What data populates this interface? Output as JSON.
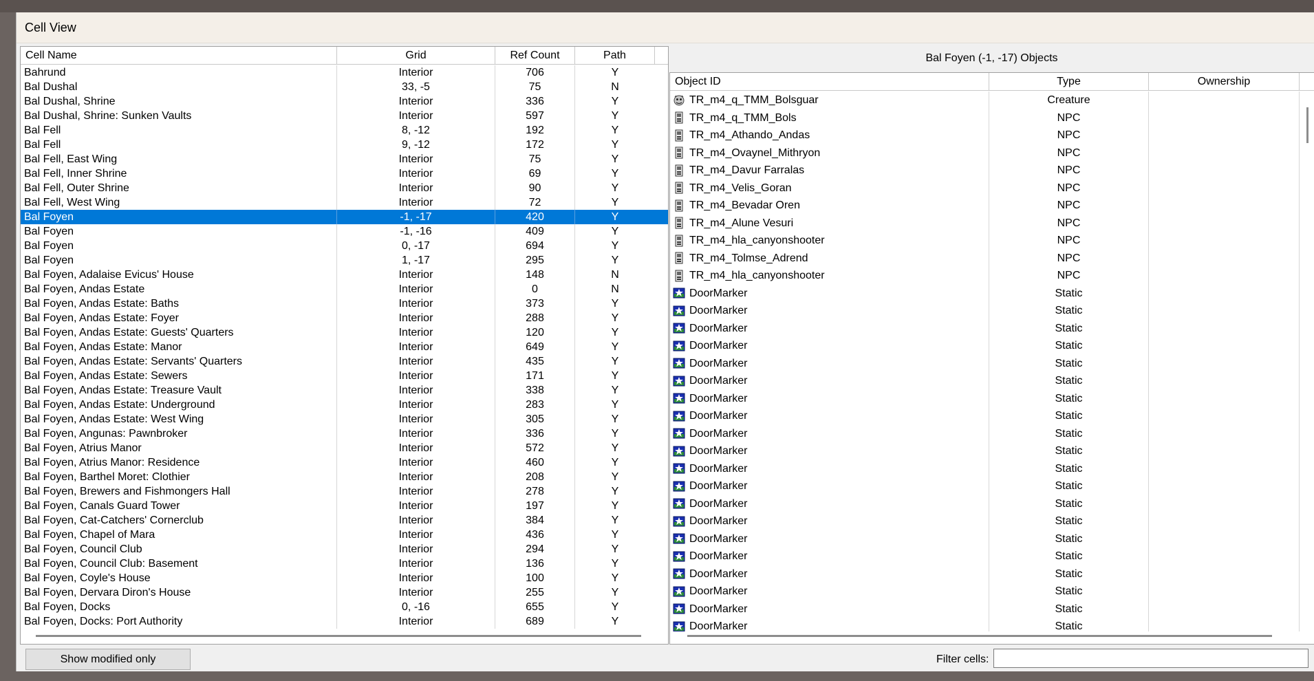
{
  "window": {
    "title": "Cell View"
  },
  "cells": {
    "columns": [
      "Cell Name",
      "Grid",
      "Ref Count",
      "Path"
    ],
    "selected_index": 10,
    "rows": [
      [
        "Bahrund",
        "Interior",
        "706",
        "Y"
      ],
      [
        "Bal Dushal",
        "33, -5",
        "75",
        "N"
      ],
      [
        "Bal Dushal, Shrine",
        "Interior",
        "336",
        "Y"
      ],
      [
        "Bal Dushal, Shrine: Sunken Vaults",
        "Interior",
        "597",
        "Y"
      ],
      [
        "Bal Fell",
        "8, -12",
        "192",
        "Y"
      ],
      [
        "Bal Fell",
        "9, -12",
        "172",
        "Y"
      ],
      [
        "Bal Fell, East Wing",
        "Interior",
        "75",
        "Y"
      ],
      [
        "Bal Fell, Inner Shrine",
        "Interior",
        "69",
        "Y"
      ],
      [
        "Bal Fell, Outer Shrine",
        "Interior",
        "90",
        "Y"
      ],
      [
        "Bal Fell, West Wing",
        "Interior",
        "72",
        "Y"
      ],
      [
        "Bal Foyen",
        "-1, -17",
        "420",
        "Y"
      ],
      [
        "Bal Foyen",
        "-1, -16",
        "409",
        "Y"
      ],
      [
        "Bal Foyen",
        "0, -17",
        "694",
        "Y"
      ],
      [
        "Bal Foyen",
        "1, -17",
        "295",
        "Y"
      ],
      [
        "Bal Foyen, Adalaise Evicus' House",
        "Interior",
        "148",
        "N"
      ],
      [
        "Bal Foyen, Andas Estate",
        "Interior",
        "0",
        "N"
      ],
      [
        "Bal Foyen, Andas Estate: Baths",
        "Interior",
        "373",
        "Y"
      ],
      [
        "Bal Foyen, Andas Estate: Foyer",
        "Interior",
        "288",
        "Y"
      ],
      [
        "Bal Foyen, Andas Estate: Guests' Quarters",
        "Interior",
        "120",
        "Y"
      ],
      [
        "Bal Foyen, Andas Estate: Manor",
        "Interior",
        "649",
        "Y"
      ],
      [
        "Bal Foyen, Andas Estate: Servants' Quarters",
        "Interior",
        "435",
        "Y"
      ],
      [
        "Bal Foyen, Andas Estate: Sewers",
        "Interior",
        "171",
        "Y"
      ],
      [
        "Bal Foyen, Andas Estate: Treasure Vault",
        "Interior",
        "338",
        "Y"
      ],
      [
        "Bal Foyen, Andas Estate: Underground",
        "Interior",
        "283",
        "Y"
      ],
      [
        "Bal Foyen, Andas Estate: West Wing",
        "Interior",
        "305",
        "Y"
      ],
      [
        "Bal Foyen, Angunas: Pawnbroker",
        "Interior",
        "336",
        "Y"
      ],
      [
        "Bal Foyen, Atrius Manor",
        "Interior",
        "572",
        "Y"
      ],
      [
        "Bal Foyen, Atrius Manor: Residence",
        "Interior",
        "460",
        "Y"
      ],
      [
        "Bal Foyen, Barthel Moret: Clothier",
        "Interior",
        "208",
        "Y"
      ],
      [
        "Bal Foyen, Brewers and Fishmongers Hall",
        "Interior",
        "278",
        "Y"
      ],
      [
        "Bal Foyen, Canals Guard Tower",
        "Interior",
        "197",
        "Y"
      ],
      [
        "Bal Foyen, Cat-Catchers' Cornerclub",
        "Interior",
        "384",
        "Y"
      ],
      [
        "Bal Foyen, Chapel of Mara",
        "Interior",
        "436",
        "Y"
      ],
      [
        "Bal Foyen, Council Club",
        "Interior",
        "294",
        "Y"
      ],
      [
        "Bal Foyen, Council Club: Basement",
        "Interior",
        "136",
        "Y"
      ],
      [
        "Bal Foyen, Coyle's House",
        "Interior",
        "100",
        "Y"
      ],
      [
        "Bal Foyen, Dervara Diron's House",
        "Interior",
        "255",
        "Y"
      ],
      [
        "Bal Foyen, Docks",
        "0, -16",
        "655",
        "Y"
      ],
      [
        "Bal Foyen, Docks: Port Authority",
        "Interior",
        "689",
        "Y"
      ]
    ]
  },
  "objects": {
    "title": "Bal Foyen (-1, -17) Objects",
    "columns": [
      "Object ID",
      "Type",
      "Ownership"
    ],
    "rows": [
      {
        "id": "TR_m4_q_TMM_Bolsguar",
        "type": "Creature",
        "owner": "",
        "icon": "creature-icon"
      },
      {
        "id": "TR_m4_q_TMM_Bols",
        "type": "NPC",
        "owner": "",
        "icon": "npc-icon"
      },
      {
        "id": "TR_m4_Athando_Andas",
        "type": "NPC",
        "owner": "",
        "icon": "npc-icon"
      },
      {
        "id": "TR_m4_Ovaynel_Mithryon",
        "type": "NPC",
        "owner": "",
        "icon": "npc-icon"
      },
      {
        "id": "TR_m4_Davur Farralas",
        "type": "NPC",
        "owner": "",
        "icon": "npc-icon"
      },
      {
        "id": "TR_m4_Velis_Goran",
        "type": "NPC",
        "owner": "",
        "icon": "npc-icon"
      },
      {
        "id": "TR_m4_Bevadar Oren",
        "type": "NPC",
        "owner": "",
        "icon": "npc-icon"
      },
      {
        "id": "TR_m4_Alune Vesuri",
        "type": "NPC",
        "owner": "",
        "icon": "npc-icon"
      },
      {
        "id": "TR_m4_hla_canyonshooter",
        "type": "NPC",
        "owner": "",
        "icon": "npc-icon"
      },
      {
        "id": "TR_m4_Tolmse_Adrend",
        "type": "NPC",
        "owner": "",
        "icon": "npc-icon"
      },
      {
        "id": "TR_m4_hla_canyonshooter",
        "type": "NPC",
        "owner": "",
        "icon": "npc-icon"
      },
      {
        "id": "DoorMarker",
        "type": "Static",
        "owner": "",
        "icon": "static-icon"
      },
      {
        "id": "DoorMarker",
        "type": "Static",
        "owner": "",
        "icon": "static-icon"
      },
      {
        "id": "DoorMarker",
        "type": "Static",
        "owner": "",
        "icon": "static-icon"
      },
      {
        "id": "DoorMarker",
        "type": "Static",
        "owner": "",
        "icon": "static-icon"
      },
      {
        "id": "DoorMarker",
        "type": "Static",
        "owner": "",
        "icon": "static-icon"
      },
      {
        "id": "DoorMarker",
        "type": "Static",
        "owner": "",
        "icon": "static-icon"
      },
      {
        "id": "DoorMarker",
        "type": "Static",
        "owner": "",
        "icon": "static-icon"
      },
      {
        "id": "DoorMarker",
        "type": "Static",
        "owner": "",
        "icon": "static-icon"
      },
      {
        "id": "DoorMarker",
        "type": "Static",
        "owner": "",
        "icon": "static-icon"
      },
      {
        "id": "DoorMarker",
        "type": "Static",
        "owner": "",
        "icon": "static-icon"
      },
      {
        "id": "DoorMarker",
        "type": "Static",
        "owner": "",
        "icon": "static-icon"
      },
      {
        "id": "DoorMarker",
        "type": "Static",
        "owner": "",
        "icon": "static-icon"
      },
      {
        "id": "DoorMarker",
        "type": "Static",
        "owner": "",
        "icon": "static-icon"
      },
      {
        "id": "DoorMarker",
        "type": "Static",
        "owner": "",
        "icon": "static-icon"
      },
      {
        "id": "DoorMarker",
        "type": "Static",
        "owner": "",
        "icon": "static-icon"
      },
      {
        "id": "DoorMarker",
        "type": "Static",
        "owner": "",
        "icon": "static-icon"
      },
      {
        "id": "DoorMarker",
        "type": "Static",
        "owner": "",
        "icon": "static-icon"
      },
      {
        "id": "DoorMarker",
        "type": "Static",
        "owner": "",
        "icon": "static-icon"
      },
      {
        "id": "DoorMarker",
        "type": "Static",
        "owner": "",
        "icon": "static-icon"
      },
      {
        "id": "DoorMarker",
        "type": "Static",
        "owner": "",
        "icon": "static-icon"
      }
    ]
  },
  "footer": {
    "show_modified_label": "Show modified only",
    "filter_label": "Filter cells:",
    "filter_value": ""
  },
  "colors": {
    "selection": "#0078d7",
    "static_icon": "#1a2fb0",
    "npc_icon": "#555555"
  }
}
